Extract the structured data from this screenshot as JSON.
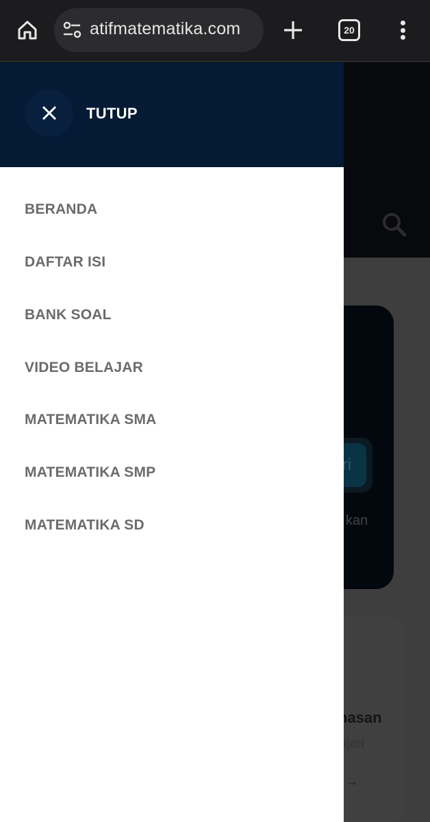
{
  "browser": {
    "url": "atifmatematika.com",
    "tab_count": "20",
    "icons": [
      "home-icon",
      "site-settings-icon",
      "new-tab-icon",
      "tab-switcher-icon",
      "more-options-icon"
    ]
  },
  "drawer": {
    "close_label": "TUTUP",
    "menu": [
      {
        "label": "BERANDA"
      },
      {
        "label": "DAFTAR ISI"
      },
      {
        "label": "BANK SOAL"
      },
      {
        "label": "VIDEO BELAJAR"
      },
      {
        "label": "MATEMATIKA SMA"
      },
      {
        "label": "MATEMATIKA SMP"
      },
      {
        "label": "MATEMATIKA SD"
      }
    ]
  },
  "background_page": {
    "button_fragment": "ri",
    "text_fragment": "kan",
    "heading_fragment": "hasan",
    "subtext_fragment": "ajari",
    "link_fragment": "i →"
  },
  "colors": {
    "drawer_header": "#051a34",
    "drawer_background": "#ffffff",
    "menu_text": "#6b6b6b",
    "browser_bar": "#1c1c1e"
  }
}
